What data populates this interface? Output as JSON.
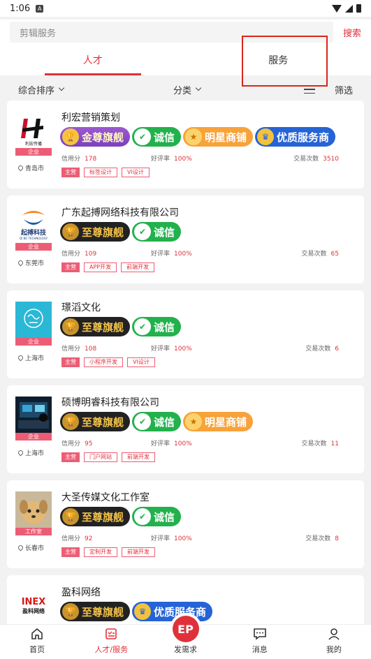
{
  "status": {
    "time": "1:06",
    "notif": "A"
  },
  "search": {
    "placeholder": "剪辑服务",
    "button": "搜索"
  },
  "tabs": [
    {
      "label": "人才"
    },
    {
      "label": "服务"
    }
  ],
  "filters": {
    "sort": "综合排序",
    "category": "分类",
    "screen": "筛选"
  },
  "labels": {
    "credit": "信用分",
    "rating": "好评率",
    "trades": "交易次数",
    "main": "主营"
  },
  "badge_text": {
    "jinzun": "金尊旗舰",
    "zhizun": "至尊旗舰",
    "chengxin": "诚信",
    "mingxing": "明星商铺",
    "youzhi": "优质服务商"
  },
  "cards": [
    {
      "name": "利宏营销策划",
      "type": "企业",
      "city": "青岛市",
      "credit": "178",
      "rating": "100%",
      "trades": "3510",
      "tags": [
        "标签设计",
        "VI设计"
      ],
      "logo_text": "利宏传播"
    },
    {
      "name": "广东起搏网络科技有限公司",
      "type": "企业",
      "city": "东莞市",
      "credit": "109",
      "rating": "100%",
      "trades": "65",
      "tags": [
        "APP开发",
        "前端开发"
      ],
      "logo_text": "起搏科技",
      "logo_sub": "QI BO TECHNOLOGY"
    },
    {
      "name": "璟滔文化",
      "type": "企业",
      "city": "上海市",
      "credit": "108",
      "rating": "100%",
      "trades": "6",
      "tags": [
        "小程序开发",
        "VI设计"
      ]
    },
    {
      "name": "硕博明睿科技有限公司",
      "type": "企业",
      "city": "上海市",
      "credit": "95",
      "rating": "100%",
      "trades": "11",
      "tags": [
        "门户网站",
        "前端开发"
      ]
    },
    {
      "name": "大圣传媒文化工作室",
      "type": "工作室",
      "city": "长春市",
      "credit": "92",
      "rating": "100%",
      "trades": "8",
      "tags": [
        "定制开发",
        "前端开发"
      ]
    },
    {
      "name": "盈科网络",
      "logo_text": "INEX",
      "logo_sub": "盈科网络"
    }
  ],
  "nav": [
    {
      "label": "首页"
    },
    {
      "label": "人才/服务"
    },
    {
      "label": "发需求",
      "icon_text": "EP"
    },
    {
      "label": "消息"
    },
    {
      "label": "我的"
    }
  ],
  "colors": {
    "accent": "#e0313a",
    "tag_pink": "#ec5d75",
    "highlight_box": "#d9261c"
  }
}
